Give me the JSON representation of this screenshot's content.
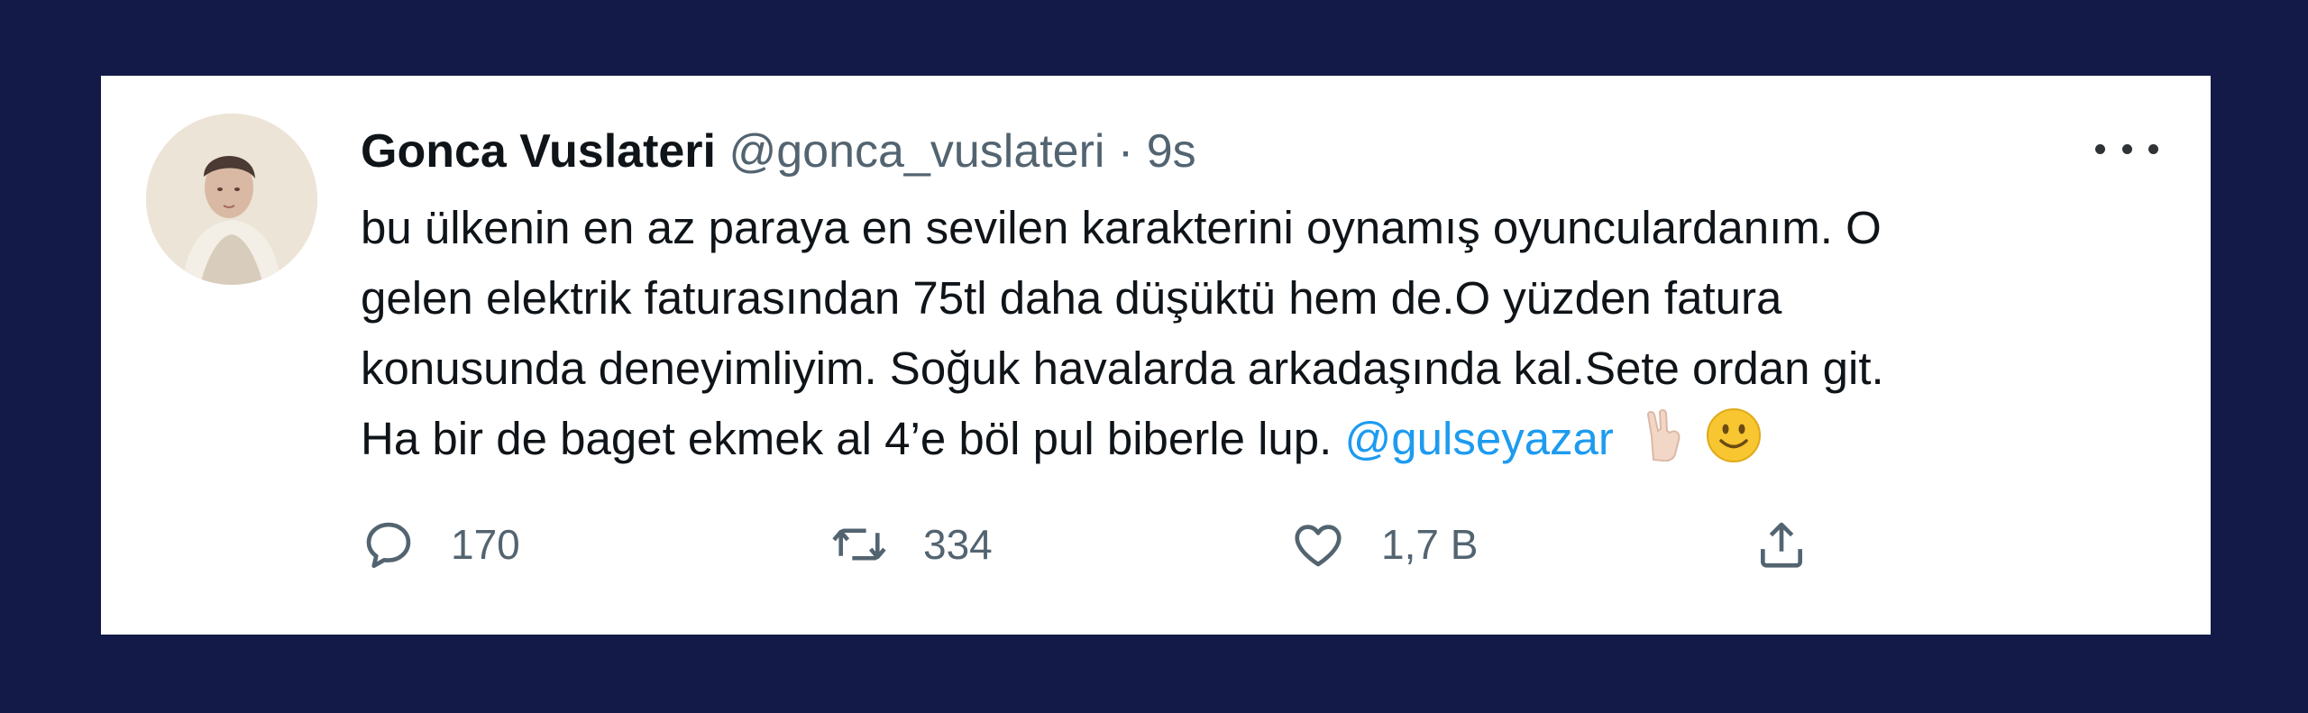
{
  "tweet": {
    "display_name": "Gonca Vuslateri",
    "handle": "@gonca_vuslateri",
    "separator": "·",
    "time": "9s",
    "text_lines": [
      "bu ülkenin en az paraya en sevilen karakterini oynamış oyunculardanım. O",
      "gelen elektrik faturasından 75tl daha düşüktü hem de.O yüzden fatura",
      "konusunda deneyimliyim. Soğuk havalarda arkadaşında kal.Sete ordan git.",
      "Ha bir de baget ekmek al 4’e böl pul biberle lup."
    ],
    "mention": "@gulseyazar",
    "icons": [
      "more-icon",
      "rock-on-hand-emoji",
      "smiling-face-emoji",
      "reply-icon",
      "retweet-icon",
      "like-icon",
      "share-icon"
    ]
  },
  "actions": {
    "reply_count": "170",
    "retweet_count": "334",
    "like_count": "1,7 B"
  },
  "colors": {
    "background": "#131a47",
    "card": "#ffffff",
    "text": "#0f1419",
    "secondary": "#536471",
    "link": "#1d9bf0"
  }
}
